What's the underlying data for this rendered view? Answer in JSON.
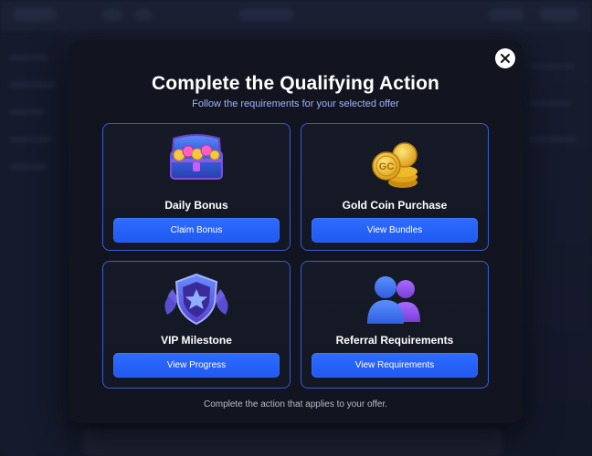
{
  "modal": {
    "title": "Complete the Qualifying Action",
    "subtitle": "Follow the requirements for your selected offer",
    "close_icon": "close-icon",
    "footer": "Complete the action that applies to your offer."
  },
  "cards": [
    {
      "label": "Daily Bonus",
      "button": "Claim Bonus",
      "icon": "treasure-chest-icon"
    },
    {
      "label": "Gold Coin Purchase",
      "button": "View Bundles",
      "icon": "gold-coins-icon"
    },
    {
      "label": "VIP Milestone",
      "button": "View Progress",
      "icon": "vip-shield-icon"
    },
    {
      "label": "Referral Requirements",
      "button": "View Requirements",
      "icon": "users-icon"
    }
  ],
  "colors": {
    "accent": "#2563ff",
    "card_border": "#3b5bd6",
    "modal_bg": "#12151f"
  }
}
